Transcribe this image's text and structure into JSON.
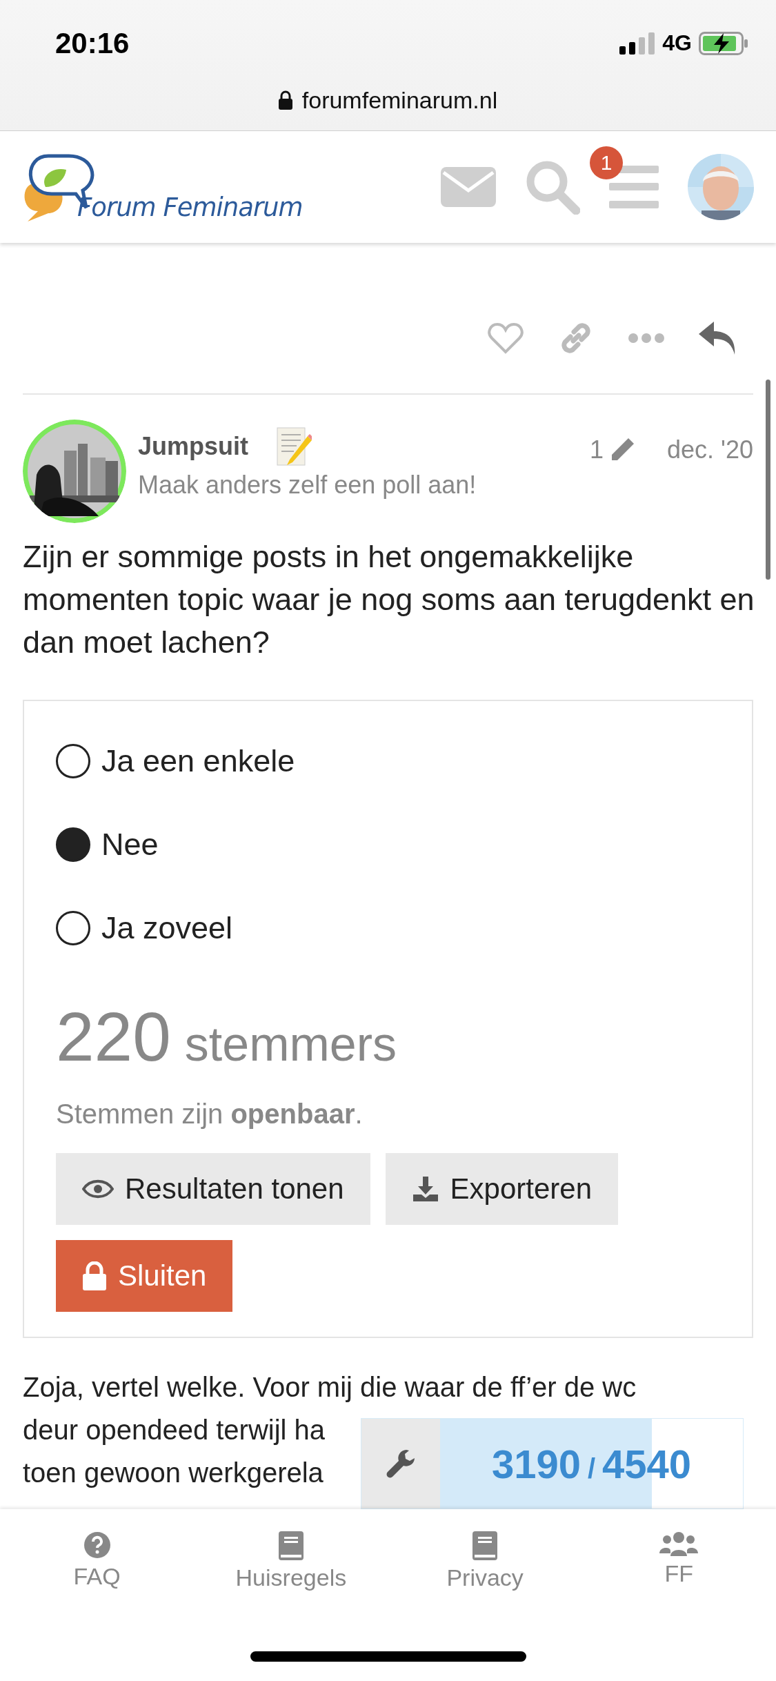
{
  "status_bar": {
    "time": "20:16",
    "network": "4G"
  },
  "browser": {
    "url": "forumfeminarum.nl"
  },
  "header": {
    "logo_text": "Forum Feminarum",
    "notification_count": "1"
  },
  "post": {
    "author": "Jumpsuit",
    "title": "Maak anders zelf een poll aan!",
    "edits": "1",
    "date": "dec. '20",
    "body": "Zijn er sommige posts in het ongemakkelijke momenten topic waar je nog soms aan terugdenkt en dan moet lachen?",
    "poll": {
      "options": [
        {
          "label": "Ja een enkele",
          "selected": false
        },
        {
          "label": "Nee",
          "selected": true
        },
        {
          "label": "Ja zoveel",
          "selected": false
        }
      ],
      "voters_count": "220",
      "voters_label": "stemmers",
      "visibility": "Stemmen zijn **openbaar**.",
      "buttons": [
        {
          "label": "Resultaten tonen",
          "kind": "eye"
        },
        {
          "label": "Exporteren",
          "kind": "download"
        },
        {
          "label": "Sluiten",
          "kind": "lock"
        }
      ]
    }
  },
  "next_post": {
    "lines": [
      "Zoja, vertel welke. Voor mij die waar de ff’er de wc",
      "deur opendeed terwijl ha",
      "toen gewoon werkgerela"
    ]
  },
  "topic_progress": {
    "current": "3190",
    "separator": "/",
    "total": "4540",
    "level": 0.7
  },
  "footer_nav": [
    {
      "label": "FAQ",
      "kind": "question"
    },
    {
      "label": "Huisregels",
      "kind": "book"
    },
    {
      "label": "Privacy",
      "kind": "book"
    },
    {
      "label": "FF",
      "kind": "users"
    }
  ]
}
